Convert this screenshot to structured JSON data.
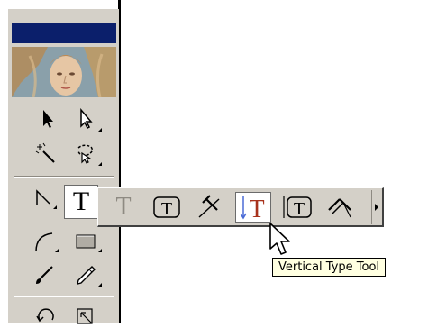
{
  "panel": {
    "title_bar_color": "#0b1f6b",
    "background_color": "#d4d0c8"
  },
  "tools": [
    {
      "name": "selection-tool",
      "icon": "arrow-icon"
    },
    {
      "name": "direct-selection-tool",
      "icon": "hollow-arrow-icon"
    },
    {
      "name": "magic-wand-tool",
      "icon": "magic-wand-icon"
    },
    {
      "name": "lasso-tool",
      "icon": "lasso-icon"
    },
    {
      "name": "pen-tool",
      "icon": "pen-icon"
    },
    {
      "name": "type-tool",
      "icon": "type-icon",
      "glyph": "T"
    },
    {
      "name": "arc-tool",
      "icon": "arc-icon"
    },
    {
      "name": "rectangle-tool",
      "icon": "rectangle-icon"
    },
    {
      "name": "paintbrush-tool",
      "icon": "brush-icon"
    },
    {
      "name": "pencil-tool",
      "icon": "pencil-icon"
    },
    {
      "name": "rotate-tool",
      "icon": "rotate-icon"
    },
    {
      "name": "scale-tool",
      "icon": "scale-icon"
    }
  ],
  "flyout": {
    "items": [
      {
        "name": "type-tool",
        "icon": "type-icon",
        "glyph": "T"
      },
      {
        "name": "area-type-tool",
        "icon": "area-type-icon",
        "glyph": "T"
      },
      {
        "name": "type-on-path-tool",
        "icon": "type-on-path-icon"
      },
      {
        "name": "vertical-type-tool",
        "icon": "vertical-type-icon",
        "glyph": "T",
        "selected": true
      },
      {
        "name": "vertical-area-type-tool",
        "icon": "vertical-area-type-icon",
        "glyph": "T"
      },
      {
        "name": "vertical-type-on-path-tool",
        "icon": "vertical-type-on-path-icon"
      }
    ],
    "selected_color": "#a8321c"
  },
  "tooltip": {
    "text": "Vertical Type Tool"
  }
}
